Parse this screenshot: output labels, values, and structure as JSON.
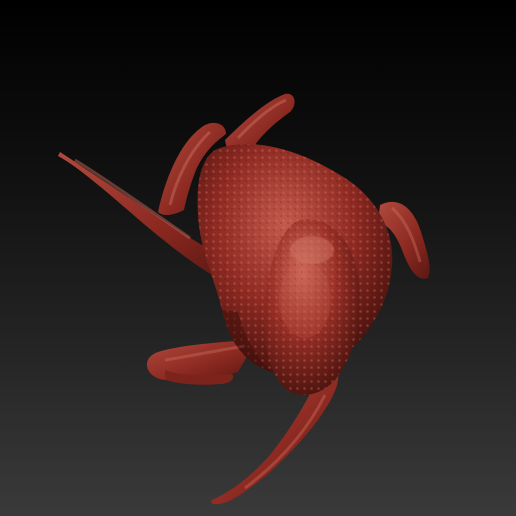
{
  "scene": {
    "subject_icon": "octopus-sculpt-icon",
    "background_top": "#000000",
    "background_bottom": "#3a3a3a",
    "material_base": "#8e2a22",
    "material_highlight": "#c45a4d",
    "material_shadow": "#4a120e"
  }
}
